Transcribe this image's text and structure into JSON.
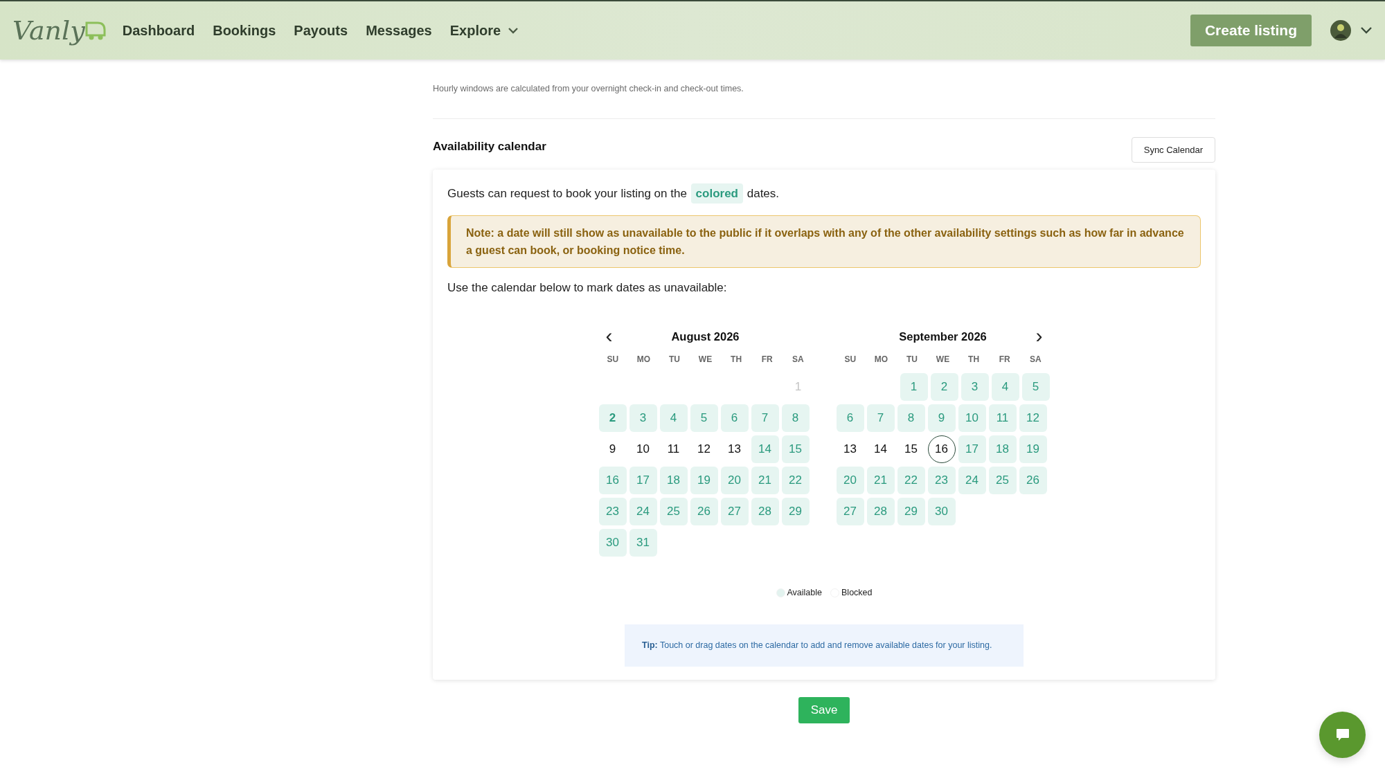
{
  "header": {
    "logo": "Vanly",
    "nav": [
      {
        "label": "Dashboard",
        "dropdown": false
      },
      {
        "label": "Bookings",
        "dropdown": false
      },
      {
        "label": "Payouts",
        "dropdown": false
      },
      {
        "label": "Messages",
        "dropdown": false
      },
      {
        "label": "Explore",
        "dropdown": true
      }
    ],
    "create_button": "Create listing"
  },
  "hourly_note": "Hourly windows are calculated from your overnight check-in and check-out times.",
  "section_title": "Availability calendar",
  "sync_button": "Sync Calendar",
  "hint": {
    "before": "Guests can request to book your listing on the",
    "highlight": "colored",
    "after": "dates."
  },
  "note": "Note: a date will still show as unavailable to the public if it overlaps with any of the other availability settings such as how far in advance a guest can book, or booking notice time.",
  "instruction": "Use the calendar below to mark dates as unavailable:",
  "prev_icon": "‹",
  "next_icon": "›",
  "months": [
    {
      "title": "August 2026",
      "weekdays": [
        "SU",
        "MO",
        "TU",
        "WE",
        "TH",
        "FR",
        "SA"
      ],
      "weeks": [
        {
          "kind": "first",
          "days": [
            {
              "label": "1",
              "available": false,
              "disabled": true,
              "today": false,
              "bold": false
            }
          ]
        },
        {
          "kind": "week",
          "days": [
            {
              "label": "2",
              "available": true,
              "disabled": false,
              "today": false,
              "bold": true
            },
            {
              "label": "3",
              "available": true,
              "disabled": false,
              "today": false,
              "bold": false
            },
            {
              "label": "4",
              "available": true,
              "disabled": false,
              "today": false,
              "bold": false
            },
            {
              "label": "5",
              "available": true,
              "disabled": false,
              "today": false,
              "bold": false
            },
            {
              "label": "6",
              "available": true,
              "disabled": false,
              "today": false,
              "bold": false
            },
            {
              "label": "7",
              "available": true,
              "disabled": false,
              "today": false,
              "bold": false
            },
            {
              "label": "8",
              "available": true,
              "disabled": false,
              "today": false,
              "bold": false
            }
          ]
        },
        {
          "kind": "week",
          "days": [
            {
              "label": "9",
              "available": false,
              "disabled": false,
              "today": false,
              "bold": false
            },
            {
              "label": "10",
              "available": false,
              "disabled": false,
              "today": false,
              "bold": false
            },
            {
              "label": "11",
              "available": false,
              "disabled": false,
              "today": false,
              "bold": false
            },
            {
              "label": "12",
              "available": false,
              "disabled": false,
              "today": false,
              "bold": false
            },
            {
              "label": "13",
              "available": false,
              "disabled": false,
              "today": false,
              "bold": false
            },
            {
              "label": "14",
              "available": true,
              "disabled": false,
              "today": false,
              "bold": false
            },
            {
              "label": "15",
              "available": true,
              "disabled": false,
              "today": false,
              "bold": false
            }
          ]
        },
        {
          "kind": "week",
          "days": [
            {
              "label": "16",
              "available": true,
              "disabled": false,
              "today": false,
              "bold": false
            },
            {
              "label": "17",
              "available": true,
              "disabled": false,
              "today": false,
              "bold": false
            },
            {
              "label": "18",
              "available": true,
              "disabled": false,
              "today": false,
              "bold": false
            },
            {
              "label": "19",
              "available": true,
              "disabled": false,
              "today": false,
              "bold": false
            },
            {
              "label": "20",
              "available": true,
              "disabled": false,
              "today": false,
              "bold": false
            },
            {
              "label": "21",
              "available": true,
              "disabled": false,
              "today": false,
              "bold": false
            },
            {
              "label": "22",
              "available": true,
              "disabled": false,
              "today": false,
              "bold": false
            }
          ]
        },
        {
          "kind": "week",
          "days": [
            {
              "label": "23",
              "available": true,
              "disabled": false,
              "today": false,
              "bold": false
            },
            {
              "label": "24",
              "available": true,
              "disabled": false,
              "today": false,
              "bold": false
            },
            {
              "label": "25",
              "available": true,
              "disabled": false,
              "today": false,
              "bold": false
            },
            {
              "label": "26",
              "available": true,
              "disabled": false,
              "today": false,
              "bold": false
            },
            {
              "label": "27",
              "available": true,
              "disabled": false,
              "today": false,
              "bold": false
            },
            {
              "label": "28",
              "available": true,
              "disabled": false,
              "today": false,
              "bold": false
            },
            {
              "label": "29",
              "available": true,
              "disabled": false,
              "today": false,
              "bold": false
            }
          ]
        },
        {
          "kind": "week",
          "days": [
            {
              "label": "30",
              "available": true,
              "disabled": false,
              "today": false,
              "bold": false
            },
            {
              "label": "31",
              "available": true,
              "disabled": false,
              "today": false,
              "bold": false
            }
          ]
        }
      ]
    },
    {
      "title": "September 2026",
      "weekdays": [
        "SU",
        "MO",
        "TU",
        "WE",
        "TH",
        "FR",
        "SA"
      ],
      "weeks": [
        {
          "kind": "first",
          "days": [
            {
              "label": "1",
              "available": true,
              "disabled": false,
              "today": false,
              "bold": false
            },
            {
              "label": "2",
              "available": true,
              "disabled": false,
              "today": false,
              "bold": false
            },
            {
              "label": "3",
              "available": true,
              "disabled": false,
              "today": false,
              "bold": false
            },
            {
              "label": "4",
              "available": true,
              "disabled": false,
              "today": false,
              "bold": false
            },
            {
              "label": "5",
              "available": true,
              "disabled": false,
              "today": false,
              "bold": false
            }
          ]
        },
        {
          "kind": "week",
          "days": [
            {
              "label": "6",
              "available": true,
              "disabled": false,
              "today": false,
              "bold": false
            },
            {
              "label": "7",
              "available": true,
              "disabled": false,
              "today": false,
              "bold": false
            },
            {
              "label": "8",
              "available": true,
              "disabled": false,
              "today": false,
              "bold": false
            },
            {
              "label": "9",
              "available": true,
              "disabled": false,
              "today": false,
              "bold": false
            },
            {
              "label": "10",
              "available": true,
              "disabled": false,
              "today": false,
              "bold": false
            },
            {
              "label": "11",
              "available": true,
              "disabled": false,
              "today": false,
              "bold": false
            },
            {
              "label": "12",
              "available": true,
              "disabled": false,
              "today": false,
              "bold": false
            }
          ]
        },
        {
          "kind": "week",
          "days": [
            {
              "label": "13",
              "available": false,
              "disabled": false,
              "today": false,
              "bold": false
            },
            {
              "label": "14",
              "available": false,
              "disabled": false,
              "today": false,
              "bold": false
            },
            {
              "label": "15",
              "available": false,
              "disabled": false,
              "today": false,
              "bold": false
            },
            {
              "label": "16",
              "available": false,
              "disabled": false,
              "today": true,
              "bold": false
            },
            {
              "label": "17",
              "available": true,
              "disabled": false,
              "today": false,
              "bold": false
            },
            {
              "label": "18",
              "available": true,
              "disabled": false,
              "today": false,
              "bold": false
            },
            {
              "label": "19",
              "available": true,
              "disabled": false,
              "today": false,
              "bold": false
            }
          ]
        },
        {
          "kind": "week",
          "days": [
            {
              "label": "20",
              "available": true,
              "disabled": false,
              "today": false,
              "bold": false
            },
            {
              "label": "21",
              "available": true,
              "disabled": false,
              "today": false,
              "bold": false
            },
            {
              "label": "22",
              "available": true,
              "disabled": false,
              "today": false,
              "bold": false
            },
            {
              "label": "23",
              "available": true,
              "disabled": false,
              "today": false,
              "bold": false
            },
            {
              "label": "24",
              "available": true,
              "disabled": false,
              "today": false,
              "bold": false
            },
            {
              "label": "25",
              "available": true,
              "disabled": false,
              "today": false,
              "bold": false
            },
            {
              "label": "26",
              "available": true,
              "disabled": false,
              "today": false,
              "bold": false
            }
          ]
        },
        {
          "kind": "week",
          "days": [
            {
              "label": "27",
              "available": true,
              "disabled": false,
              "today": false,
              "bold": false
            },
            {
              "label": "28",
              "available": true,
              "disabled": false,
              "today": false,
              "bold": false
            },
            {
              "label": "29",
              "available": true,
              "disabled": false,
              "today": false,
              "bold": false
            },
            {
              "label": "30",
              "available": true,
              "disabled": false,
              "today": false,
              "bold": false
            }
          ]
        }
      ]
    }
  ],
  "legend": [
    {
      "label": "Available",
      "color": "#e3f3ef"
    },
    {
      "label": "Blocked",
      "color": "#ffffff"
    }
  ],
  "tip": "**Tip:** Touch or drag dates on the calendar to add and remove available dates for your listing.",
  "save_button": "Save"
}
